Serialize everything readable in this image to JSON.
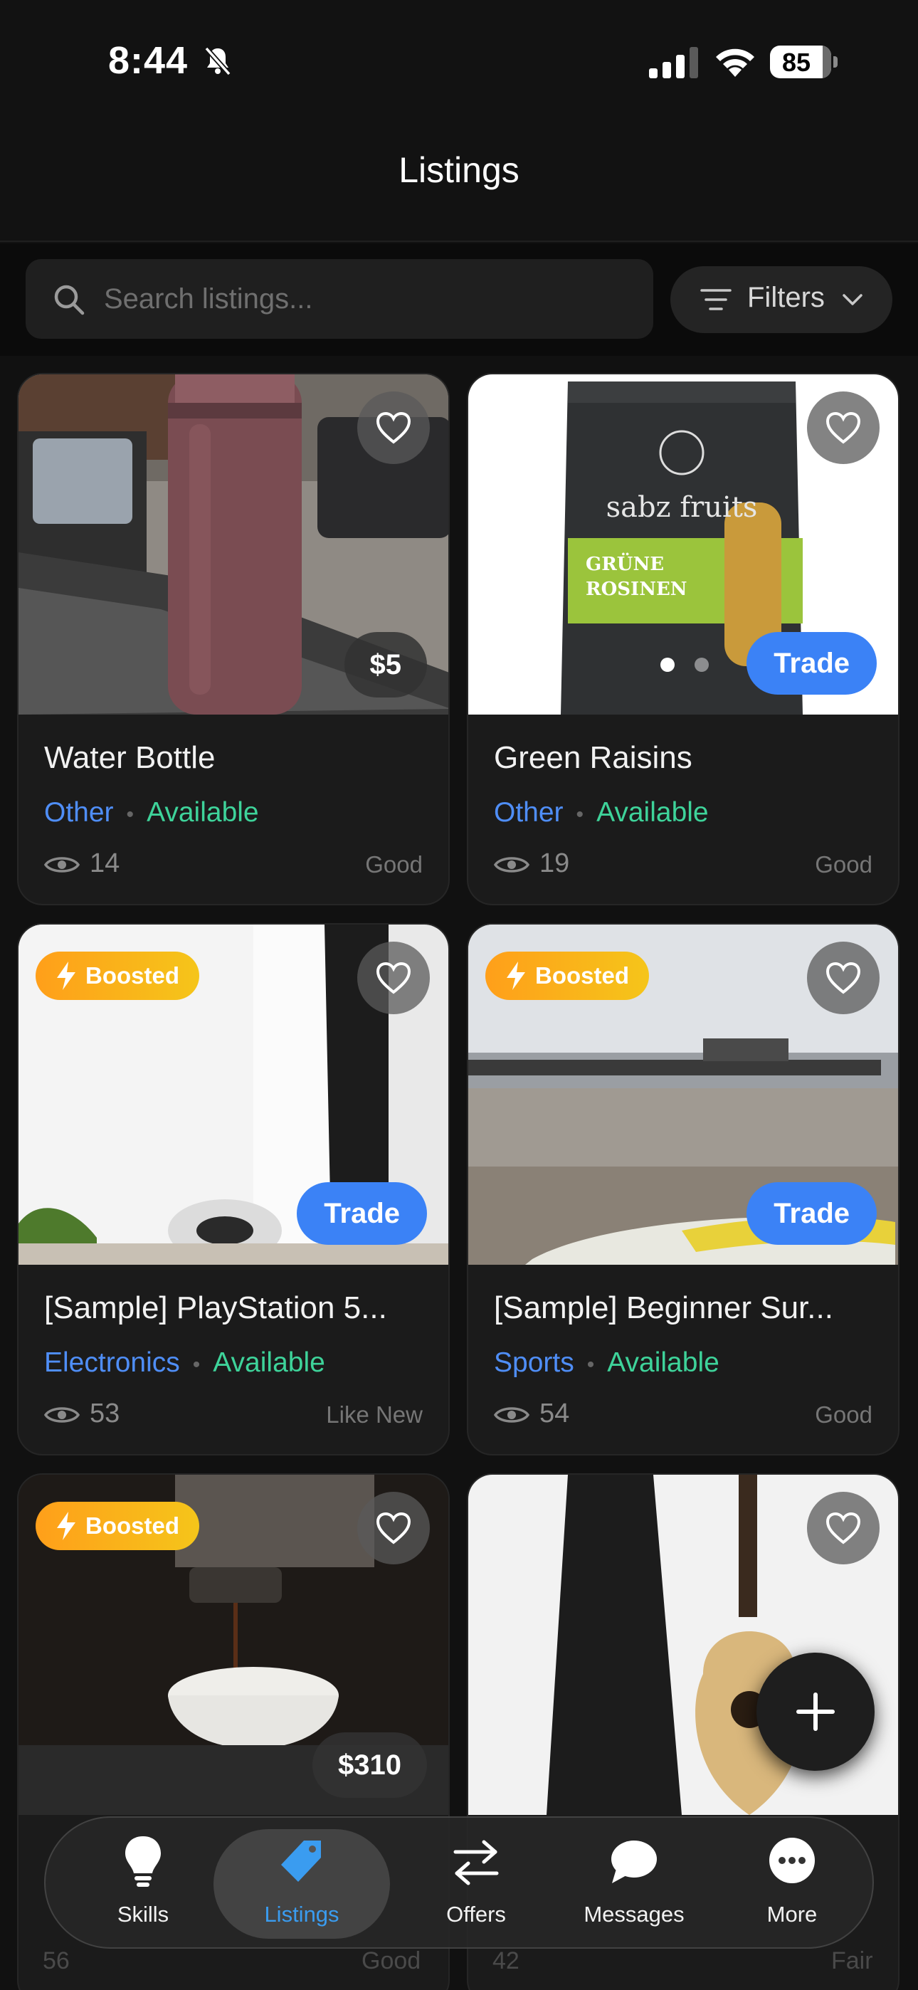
{
  "status_bar": {
    "time": "8:44",
    "battery": "85"
  },
  "header": {
    "title": "Listings"
  },
  "search": {
    "placeholder": "Search listings..."
  },
  "filters": {
    "label": "Filters"
  },
  "listings": [
    {
      "title": "Water Bottle",
      "category": "Other",
      "status": "Available",
      "views": "14",
      "condition": "Good",
      "price": "$5"
    },
    {
      "title": "Green Raisins",
      "category": "Other",
      "status": "Available",
      "views": "19",
      "condition": "Good",
      "badge": "Trade"
    },
    {
      "title": "[Sample] PlayStation 5...",
      "category": "Electronics",
      "status": "Available",
      "views": "53",
      "condition": "Like New",
      "badge": "Trade",
      "boosted": "Boosted"
    },
    {
      "title": "[Sample] Beginner Sur...",
      "category": "Sports",
      "status": "Available",
      "views": "54",
      "condition": "Good",
      "badge": "Trade",
      "boosted": "Boosted"
    },
    {
      "price": "$310",
      "boosted": "Boosted",
      "views": "56",
      "condition": "Good"
    },
    {
      "views": "42",
      "condition": "Fair"
    }
  ],
  "tabbar": {
    "items": [
      {
        "label": "Skills",
        "icon": "lightbulb-icon"
      },
      {
        "label": "Listings",
        "icon": "tag-icon"
      },
      {
        "label": "Offers",
        "icon": "swap-arrows-icon"
      },
      {
        "label": "Messages",
        "icon": "chat-bubble-icon"
      },
      {
        "label": "More",
        "icon": "more-dots-icon"
      }
    ],
    "active": "Listings"
  },
  "colors": {
    "accent": "#3b82f6",
    "available": "#3ed39a",
    "category": "#4f8ef7",
    "boosted_start": "#ff9f1a",
    "boosted_end": "#f5c51a",
    "tab_active": "#3a9cf0"
  }
}
